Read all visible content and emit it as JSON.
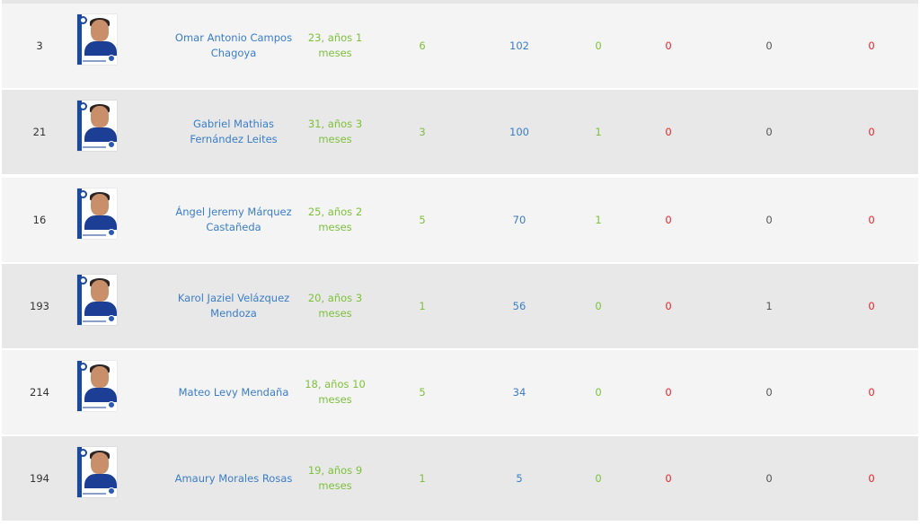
{
  "table": {
    "rows": [
      {
        "number": "3",
        "name": "Omar Antonio Campos Chagoya",
        "age": "23, años 1 meses",
        "matches": "6",
        "minutes": "102",
        "goals": "0",
        "yellow_cards": "0",
        "col_7": "0",
        "col_8": "0"
      },
      {
        "number": "21",
        "name": "Gabriel Mathias Fernández Leites",
        "age": "31, años 3 meses",
        "matches": "3",
        "minutes": "100",
        "goals": "1",
        "yellow_cards": "0",
        "col_7": "0",
        "col_8": "0"
      },
      {
        "number": "16",
        "name": "Ángel Jeremy Márquez Castañeda",
        "age": "25, años 2 meses",
        "matches": "5",
        "minutes": "70",
        "goals": "1",
        "yellow_cards": "0",
        "col_7": "0",
        "col_8": "0"
      },
      {
        "number": "193",
        "name": "Karol Jaziel Velázquez Mendoza",
        "age": "20, años 3 meses",
        "matches": "1",
        "minutes": "56",
        "goals": "0",
        "yellow_cards": "0",
        "col_7": "1",
        "col_8": "0"
      },
      {
        "number": "214",
        "name": "Mateo Levy Mendaña",
        "age": "18, años 10 meses",
        "matches": "5",
        "minutes": "34",
        "goals": "0",
        "yellow_cards": "0",
        "col_7": "0",
        "col_8": "0"
      },
      {
        "number": "194",
        "name": "Amaury Morales Rosas",
        "age": "19, años 9 meses",
        "matches": "1",
        "minutes": "5",
        "goals": "0",
        "yellow_cards": "0",
        "col_7": "0",
        "col_8": "0"
      }
    ]
  },
  "icons": {
    "player_photo": "player-photo-icon"
  },
  "colors": {
    "link_blue": "#3a7dc9",
    "stat_green": "#7ec03c",
    "stat_red": "#e8262a",
    "row_light": "#f4f4f4",
    "row_dark": "#e8e8e8"
  }
}
